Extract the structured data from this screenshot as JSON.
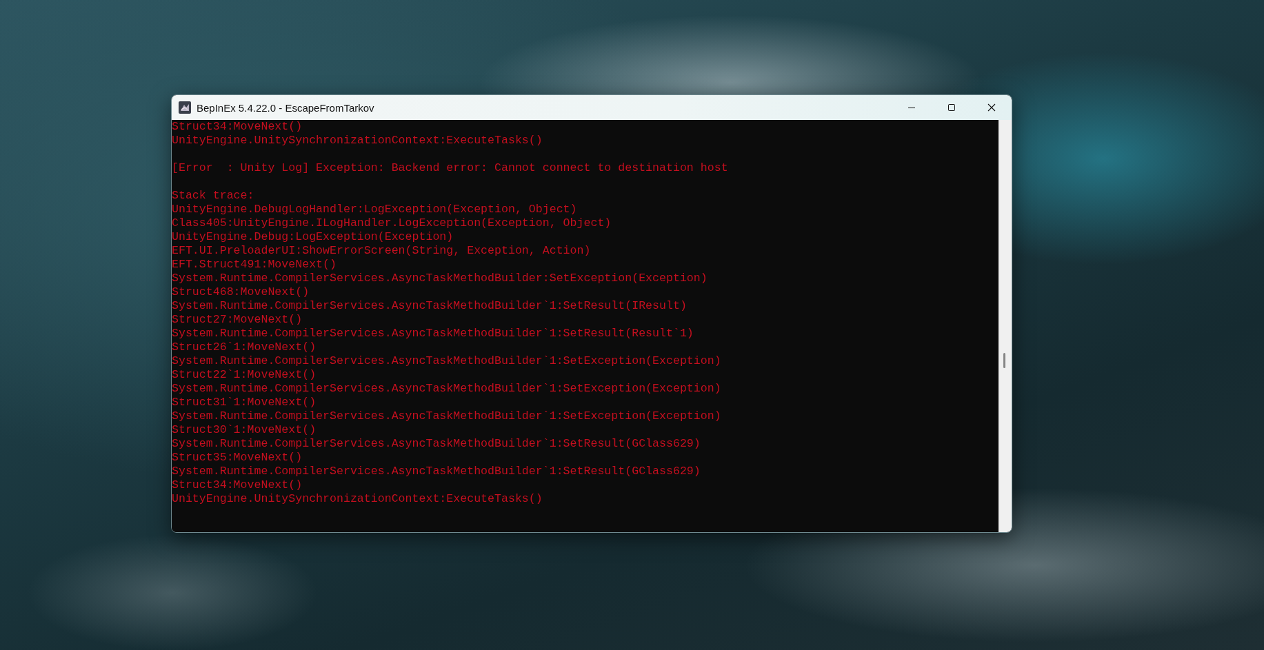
{
  "window": {
    "title": "BepInEx 5.4.22.0 - EscapeFromTarkov"
  },
  "console": {
    "blocks": [
      [
        "Struct34:MoveNext()",
        "UnityEngine.UnitySynchronizationContext:ExecuteTasks()"
      ],
      [
        "[Error  : Unity Log] Exception: Backend error: Cannot connect to destination host"
      ],
      [
        "Stack trace:",
        "UnityEngine.DebugLogHandler:LogException(Exception, Object)",
        "Class405:UnityEngine.ILogHandler.LogException(Exception, Object)",
        "UnityEngine.Debug:LogException(Exception)",
        "EFT.UI.PreloaderUI:ShowErrorScreen(String, Exception, Action)",
        "EFT.Struct491:MoveNext()",
        "System.Runtime.CompilerServices.AsyncTaskMethodBuilder:SetException(Exception)",
        "Struct468:MoveNext()",
        "System.Runtime.CompilerServices.AsyncTaskMethodBuilder`1:SetResult(IResult)",
        "Struct27:MoveNext()",
        "System.Runtime.CompilerServices.AsyncTaskMethodBuilder`1:SetResult(Result`1)",
        "Struct26`1:MoveNext()",
        "System.Runtime.CompilerServices.AsyncTaskMethodBuilder`1:SetException(Exception)",
        "Struct22`1:MoveNext()",
        "System.Runtime.CompilerServices.AsyncTaskMethodBuilder`1:SetException(Exception)",
        "Struct31`1:MoveNext()",
        "System.Runtime.CompilerServices.AsyncTaskMethodBuilder`1:SetException(Exception)",
        "Struct30`1:MoveNext()",
        "System.Runtime.CompilerServices.AsyncTaskMethodBuilder`1:SetResult(GClass629)",
        "Struct35:MoveNext()",
        "System.Runtime.CompilerServices.AsyncTaskMethodBuilder`1:SetResult(GClass629)",
        "Struct34:MoveNext()",
        "UnityEngine.UnitySynchronizationContext:ExecuteTasks()"
      ]
    ]
  }
}
